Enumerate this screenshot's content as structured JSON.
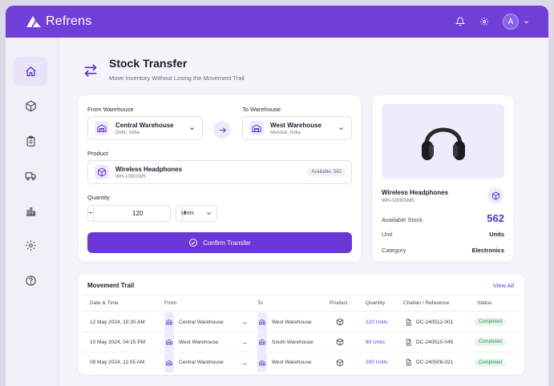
{
  "app": {
    "brand": "Refrens",
    "avatar_initial": "A"
  },
  "colors": {
    "accent": "#6a37d6",
    "topbar": "#6f3fd8",
    "success": "#2b8a52"
  },
  "sidebar": {
    "items": [
      {
        "name": "home",
        "icon": "home-icon",
        "active": true
      },
      {
        "name": "inventory",
        "icon": "cube-icon",
        "active": false
      },
      {
        "name": "orders",
        "icon": "clipboard-icon",
        "active": false
      },
      {
        "name": "shipping",
        "icon": "truck-icon",
        "active": false
      },
      {
        "name": "reports",
        "icon": "bar-chart-icon",
        "active": false
      },
      {
        "name": "settings",
        "icon": "gear-icon",
        "active": false
      },
      {
        "name": "help",
        "icon": "help-icon",
        "active": false
      }
    ]
  },
  "page": {
    "title": "Stock Transfer",
    "subtitle": "Move Inventory Without Losing the Movement Trail"
  },
  "form": {
    "from_label": "From Warehouse",
    "from": {
      "name": "Central Warehouse",
      "location": "Delhi, India"
    },
    "to_label": "To Warehouse",
    "to": {
      "name": "West Warehouse",
      "location": "Mumbai, India"
    },
    "product_label": "Product",
    "product": {
      "name": "Wireless Headphones",
      "sku": "WH-1000XM5",
      "available": "Available: 562"
    },
    "quantity_label": "Quantity",
    "quantity": "120",
    "unit": "Units",
    "confirm_label": "Confirm Transfer"
  },
  "preview": {
    "name": "Wireless Headphones",
    "sku": "WH-1000XM5",
    "available_label": "Available Stock",
    "available_value": "562",
    "unit_label": "Unit",
    "unit_value": "Units",
    "category_label": "Category",
    "category_value": "Electronics"
  },
  "trail": {
    "title": "Movement Trail",
    "view_all": "View All",
    "columns": [
      "Date & Time",
      "From",
      "To",
      "Product",
      "Quantity",
      "Challan / Reference",
      "Status"
    ],
    "rows": [
      {
        "date": "12 May 2024, 10:30 AM",
        "from": "Central Warehouse",
        "to": "West Warehouse",
        "qty": "120 Units",
        "ref": "DC-240512-001",
        "status": "Completed"
      },
      {
        "date": "10 May 2024, 04:15 PM",
        "from": "West Warehouse",
        "to": "South Warehouse",
        "qty": "80 Units",
        "ref": "DC-240510-045",
        "status": "Completed"
      },
      {
        "date": "08 May 2024, 11:05 AM",
        "from": "Central Warehouse",
        "to": "West Warehouse",
        "qty": "200 Units",
        "ref": "DC-240508-021",
        "status": "Completed"
      }
    ]
  }
}
